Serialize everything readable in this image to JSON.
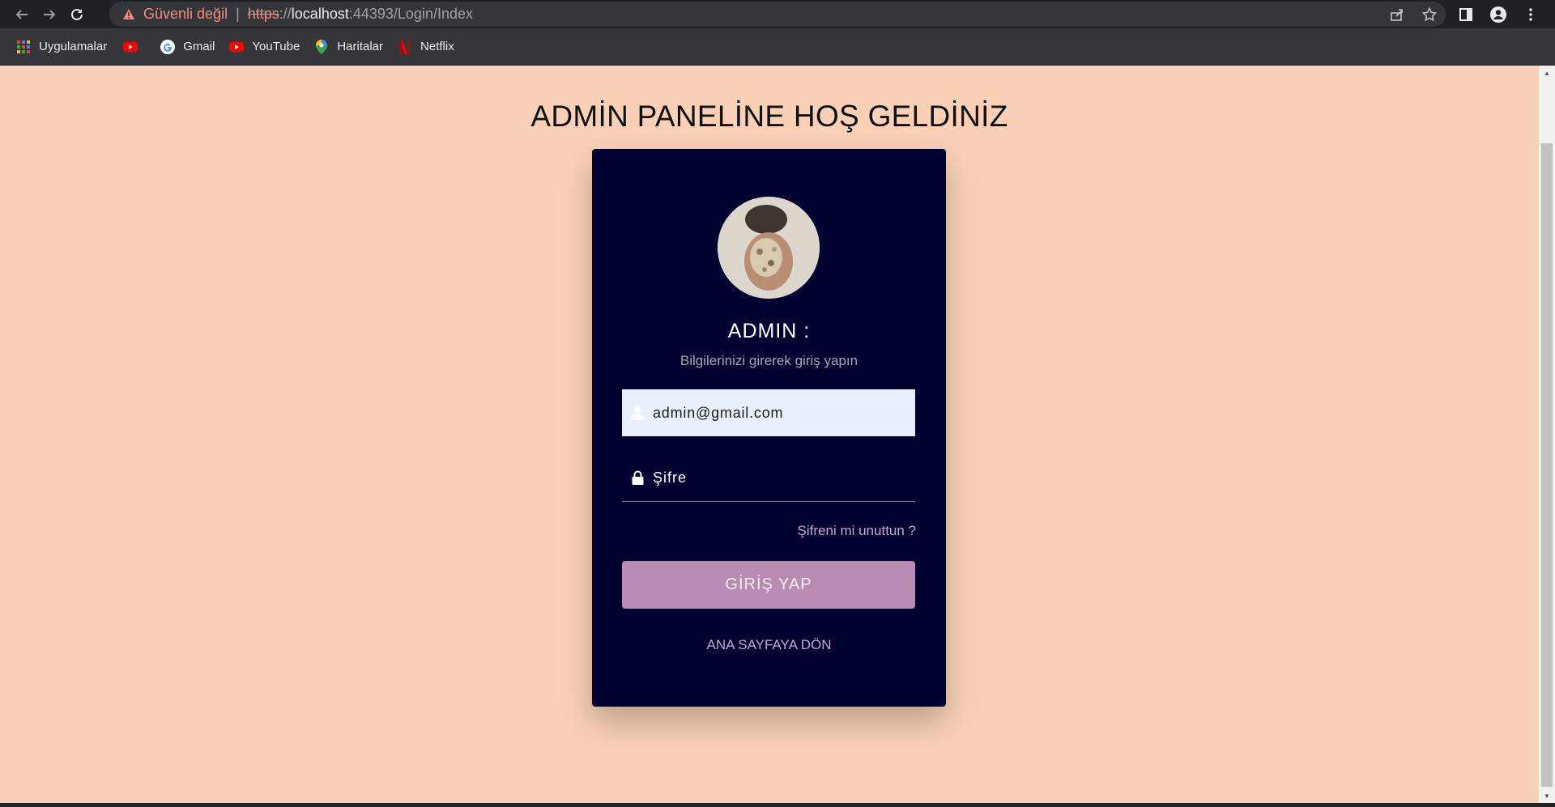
{
  "browser": {
    "security_label": "Güvenli değil",
    "url_scheme": "https",
    "url_scheme_rest": "://",
    "url_host": "localhost",
    "url_path": ":44393/Login/Index"
  },
  "bookmarks": [
    {
      "label": "Uygulamalar",
      "icon": "apps-grid-icon"
    },
    {
      "label": "",
      "icon": "youtube-icon"
    },
    {
      "label": "Gmail",
      "icon": "google-icon"
    },
    {
      "label": "YouTube",
      "icon": "youtube-icon"
    },
    {
      "label": "Haritalar",
      "icon": "maps-pin-icon"
    },
    {
      "label": "Netflix",
      "icon": "netflix-icon"
    }
  ],
  "page": {
    "title": "ADMİN PANELİNE HOŞ GELDİNİZ"
  },
  "login": {
    "card_title": "ADMIN :",
    "subtitle": "Bilgilerinizi girerek giriş yapın",
    "email_value": "admin@gmail.com",
    "password_placeholder": "Şifre",
    "forgot_label": "Şifreni mi unuttun ?",
    "submit_label": "GİRİŞ YAP",
    "home_label": "ANA SAYFAYA DÖN"
  },
  "colors": {
    "page_bg": "#fad1b6",
    "card_bg": "#020230",
    "button_bg": "#b88ab4",
    "link": "#c4a7cf",
    "input_bg": "#e8f0fe"
  }
}
